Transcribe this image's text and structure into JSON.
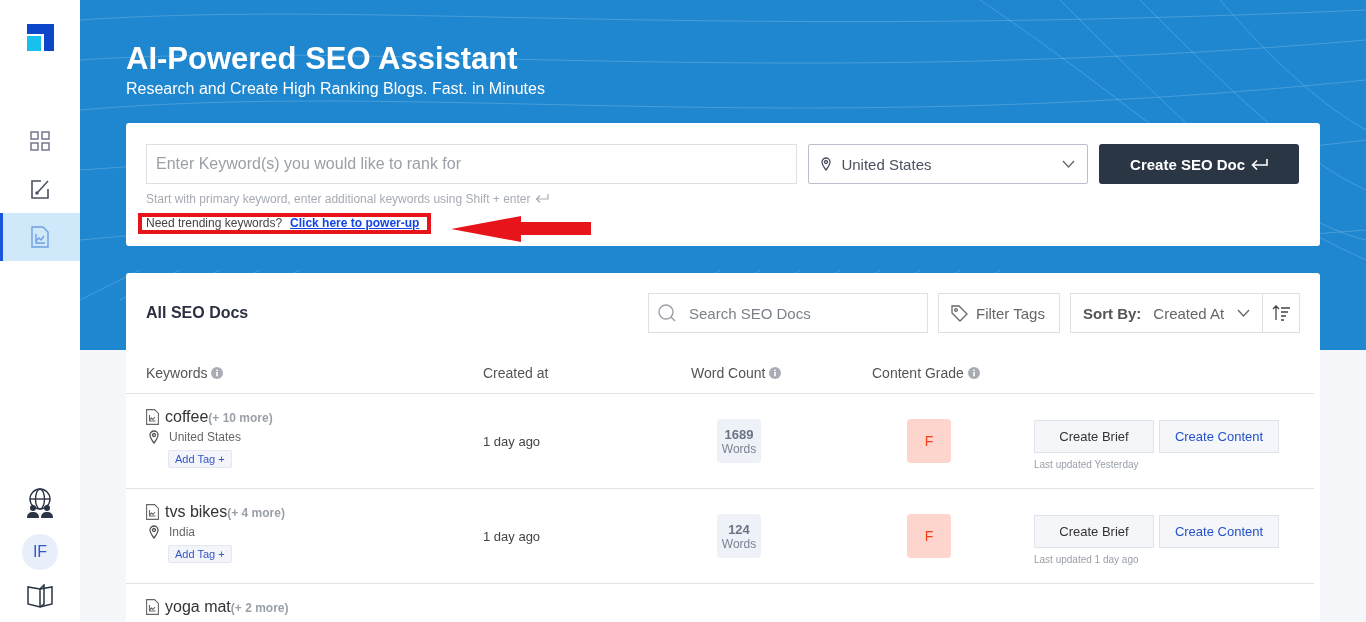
{
  "sidebar": {
    "nav_items": [
      {
        "kind": "grid",
        "selected": false
      },
      {
        "kind": "edit",
        "selected": false
      },
      {
        "kind": "chart",
        "selected": true
      }
    ],
    "avatar": "IF"
  },
  "hero": {
    "title": "AI-Powered SEO Assistant",
    "subtitle": "Research and Create High Ranking Blogs. Fast. in Minutes"
  },
  "keyword_form": {
    "placeholder": "Enter Keyword(s) you would like to rank for",
    "location": "United States",
    "create_button": "Create SEO Doc",
    "hint": "Start with primary keyword, enter additional keywords using Shift + enter",
    "trending_text": "Need trending keywords?",
    "trending_link": "Click here to power-up",
    "annotation": true
  },
  "docs": {
    "title": "All SEO Docs",
    "search_placeholder": "Search SEO Docs",
    "filter_button": "Filter Tags",
    "sort_label": "Sort By:",
    "sort_value": "Created At",
    "columns": [
      "Keywords",
      "Created at",
      "Word Count",
      "Content Grade"
    ],
    "rows": [
      {
        "kind": "full",
        "keyword": "coffee",
        "more": "(+ 10 more)",
        "location": "United States",
        "tag_button": "Add Tag +",
        "created": "1 day ago",
        "word_count": "1689",
        "words_label": "Words",
        "grade": "F",
        "brief_button": "Create Brief",
        "content_button": "Create Content",
        "updated": "Last updated Yesterday"
      },
      {
        "kind": "full",
        "keyword": "tvs bikes",
        "more": "(+ 4 more)",
        "location": "India",
        "tag_button": "Add Tag +",
        "created": "1 day ago",
        "word_count": "124",
        "words_label": "Words",
        "grade": "F",
        "brief_button": "Create Brief",
        "content_button": "Create Content",
        "updated": "Last updated 1 day ago"
      },
      {
        "kind": "partial",
        "keyword": "yoga mat",
        "more": "(+ 2 more)"
      }
    ]
  }
}
